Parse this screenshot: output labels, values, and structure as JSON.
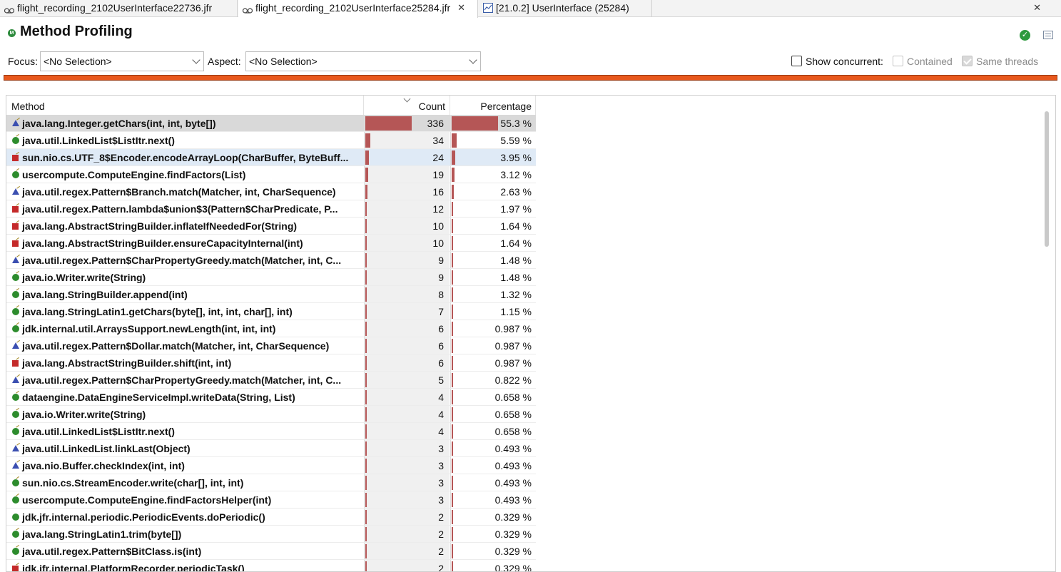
{
  "tabs": [
    {
      "label": "flight_recording_2102UserInterface22736.jfr",
      "icon": "recording-icon",
      "active": false
    },
    {
      "label": "flight_recording_2102UserInterface25284.jfr",
      "icon": "recording-icon",
      "active": true,
      "close": "✕"
    },
    {
      "label": "[21.0.2] UserInterface (25284)",
      "icon": "console-icon",
      "active": false
    }
  ],
  "window_close": "✕",
  "header": {
    "title": "Method Profiling",
    "status_icon": "ok-check-icon"
  },
  "focus": {
    "focus_label": "Focus:",
    "focus_value": "<No Selection>",
    "aspect_label": "Aspect:",
    "aspect_value": "<No Selection>",
    "show_concurrent_label": "Show concurrent:",
    "contained_label": "Contained",
    "same_threads_label": "Same threads"
  },
  "colors": {
    "accent_bar": "#e8581d",
    "count_bar": "#b55656"
  },
  "table": {
    "columns": [
      "Method",
      "Count",
      "Percentage"
    ],
    "rows": [
      {
        "icon": "blue",
        "method": "java.lang.Integer.getChars(int, int, byte[])",
        "count": "336",
        "pct": "55.3 %",
        "frac": 0.553
      },
      {
        "icon": "green",
        "method": "java.util.LinkedList$ListItr.next()",
        "count": "34",
        "pct": "5.59 %",
        "frac": 0.0559
      },
      {
        "icon": "red",
        "method": "sun.nio.cs.UTF_8$Encoder.encodeArrayLoop(CharBuffer, ByteBuff...",
        "count": "24",
        "pct": "3.95 %",
        "frac": 0.0395
      },
      {
        "icon": "green",
        "method": "usercompute.ComputeEngine.findFactors(List)",
        "count": "19",
        "pct": "3.12 %",
        "frac": 0.0312
      },
      {
        "icon": "blue",
        "method": "java.util.regex.Pattern$Branch.match(Matcher, int, CharSequence)",
        "count": "16",
        "pct": "2.63 %",
        "frac": 0.0263
      },
      {
        "icon": "red",
        "method": "java.util.regex.Pattern.lambda$union$3(Pattern$CharPredicate, P...",
        "count": "12",
        "pct": "1.97 %",
        "frac": 0.0197
      },
      {
        "icon": "red",
        "method": "java.lang.AbstractStringBuilder.inflateIfNeededFor(String)",
        "count": "10",
        "pct": "1.64 %",
        "frac": 0.0164
      },
      {
        "icon": "red",
        "method": "java.lang.AbstractStringBuilder.ensureCapacityInternal(int)",
        "count": "10",
        "pct": "1.64 %",
        "frac": 0.0164
      },
      {
        "icon": "blue",
        "method": "java.util.regex.Pattern$CharPropertyGreedy.match(Matcher, int, C...",
        "count": "9",
        "pct": "1.48 %",
        "frac": 0.0148
      },
      {
        "icon": "green",
        "method": "java.io.Writer.write(String)",
        "count": "9",
        "pct": "1.48 %",
        "frac": 0.0148
      },
      {
        "icon": "green",
        "method": "java.lang.StringBuilder.append(int)",
        "count": "8",
        "pct": "1.32 %",
        "frac": 0.0132
      },
      {
        "icon": "green",
        "method": "java.lang.StringLatin1.getChars(byte[], int, int, char[], int)",
        "count": "7",
        "pct": "1.15 %",
        "frac": 0.0115
      },
      {
        "icon": "green",
        "method": "jdk.internal.util.ArraysSupport.newLength(int, int, int)",
        "count": "6",
        "pct": "0.987 %",
        "frac": 0.00987
      },
      {
        "icon": "blue",
        "method": "java.util.regex.Pattern$Dollar.match(Matcher, int, CharSequence)",
        "count": "6",
        "pct": "0.987 %",
        "frac": 0.00987
      },
      {
        "icon": "red",
        "method": "java.lang.AbstractStringBuilder.shift(int, int)",
        "count": "6",
        "pct": "0.987 %",
        "frac": 0.00987
      },
      {
        "icon": "blue",
        "method": "java.util.regex.Pattern$CharPropertyGreedy.match(Matcher, int, C...",
        "count": "5",
        "pct": "0.822 %",
        "frac": 0.00822
      },
      {
        "icon": "green",
        "method": "dataengine.DataEngineServiceImpl.writeData(String, List)",
        "count": "4",
        "pct": "0.658 %",
        "frac": 0.00658
      },
      {
        "icon": "green",
        "method": "java.io.Writer.write(String)",
        "count": "4",
        "pct": "0.658 %",
        "frac": 0.00658
      },
      {
        "icon": "green",
        "method": "java.util.LinkedList$ListItr.next()",
        "count": "4",
        "pct": "0.658 %",
        "frac": 0.00658
      },
      {
        "icon": "blue",
        "method": "java.util.LinkedList.linkLast(Object)",
        "count": "3",
        "pct": "0.493 %",
        "frac": 0.00493
      },
      {
        "icon": "blue",
        "method": "java.nio.Buffer.checkIndex(int, int)",
        "count": "3",
        "pct": "0.493 %",
        "frac": 0.00493
      },
      {
        "icon": "green",
        "method": "sun.nio.cs.StreamEncoder.write(char[], int, int)",
        "count": "3",
        "pct": "0.493 %",
        "frac": 0.00493
      },
      {
        "icon": "green",
        "method": "usercompute.ComputeEngine.findFactorsHelper(int)",
        "count": "3",
        "pct": "0.493 %",
        "frac": 0.00493
      },
      {
        "icon": "dot",
        "method": "jdk.jfr.internal.periodic.PeriodicEvents.doPeriodic()",
        "count": "2",
        "pct": "0.329 %",
        "frac": 0.00329
      },
      {
        "icon": "green",
        "method": "java.lang.StringLatin1.trim(byte[])",
        "count": "2",
        "pct": "0.329 %",
        "frac": 0.00329
      },
      {
        "icon": "green",
        "method": "java.util.regex.Pattern$BitClass.is(int)",
        "count": "2",
        "pct": "0.329 %",
        "frac": 0.00329
      },
      {
        "icon": "red",
        "method": "jdk.jfr.internal.PlatformRecorder.periodicTask()",
        "count": "2",
        "pct": "0.329 %",
        "frac": 0.00329
      }
    ]
  }
}
